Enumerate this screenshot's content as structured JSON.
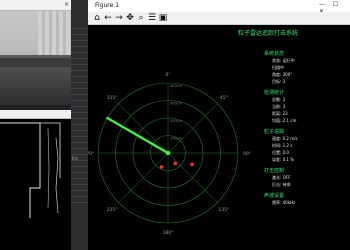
{
  "camera": {
    "title": "",
    "close": "×"
  },
  "edges": {
    "title": ""
  },
  "editor": {
    "tab": "Kin"
  },
  "figure": {
    "title": "Figure 1",
    "controls": "— ☐ ✕",
    "plot_title": "粒子雷达追踪打击系统",
    "tools": [
      {
        "icon": "home-icon",
        "glyph": "⌂"
      },
      {
        "icon": "back-arrow-icon",
        "glyph": "←"
      },
      {
        "icon": "forward-arrow-icon",
        "glyph": "→"
      },
      {
        "icon": "pan-icon",
        "glyph": "✥"
      },
      {
        "icon": "zoom-icon",
        "glyph": "⌕"
      },
      {
        "icon": "configure-icon",
        "glyph": "☰"
      },
      {
        "icon": "save-icon",
        "glyph": "▣"
      }
    ]
  },
  "radar": {
    "angle_labels": [
      "0°",
      "45°",
      "90°",
      "135°",
      "180°",
      "225°",
      "270°",
      "315°"
    ],
    "range_labels": [
      "100cm",
      "200cm",
      "300cm",
      "400cm"
    ],
    "sweep_angle_deg": 300,
    "targets": [
      {
        "angle_deg": 145,
        "range_frac": 0.18
      },
      {
        "angle_deg": 205,
        "range_frac": 0.22
      },
      {
        "angle_deg": 115,
        "range_frac": 0.38
      }
    ],
    "colors": {
      "grid": "#1f7a2a",
      "sweep": "#34ff3a",
      "target": "#ff2a2a",
      "text": "#2ee86a"
    }
  },
  "panel": {
    "sections": [
      {
        "header": "系统状态",
        "items": [
          "状态: 运行中",
          "扫描中",
          "角度: 300°",
          "目标: 3"
        ]
      },
      {
        "header": "检测统计",
        "items": [
          "总数: 3",
          "当前: 3",
          "距离: 23",
          "均值: 2.1 cm"
        ]
      },
      {
        "header": "粒子追踪",
        "items": [
          "速度: 0.2 m/s",
          "时间: 1.2 s",
          "位置: 0.0",
          "误差: 0.1 %"
        ]
      },
      {
        "header": "打击控制",
        "items": [
          "激光: OFF",
          "打击: 待命"
        ]
      },
      {
        "header": "声波设置",
        "items": [
          "频率: 40kHz"
        ]
      }
    ]
  }
}
